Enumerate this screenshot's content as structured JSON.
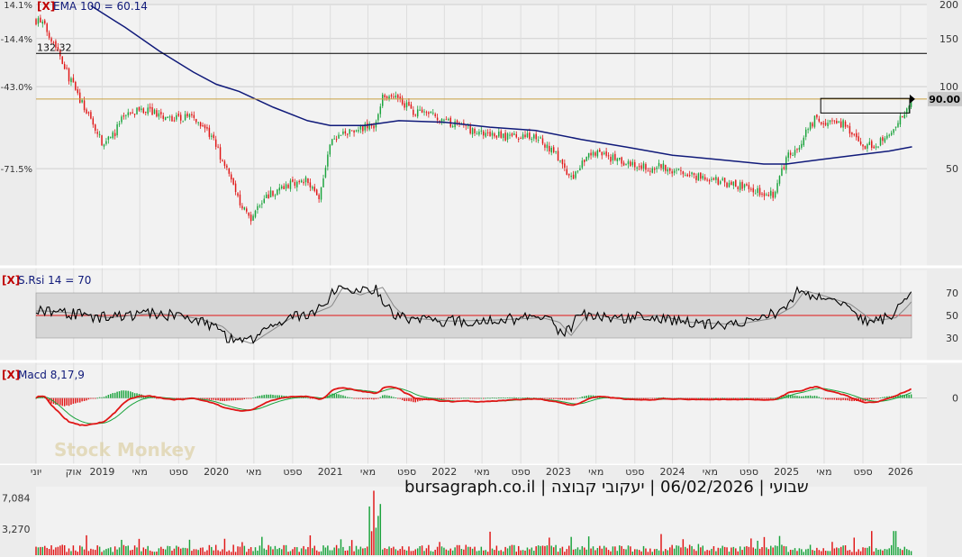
{
  "chart_data": [
    {
      "type": "candlestick",
      "panel": "price",
      "indicator_label": "EMA 100 = 60.14",
      "y_axis_right": [
        "200",
        "150",
        "100",
        "50"
      ],
      "y_axis_left": [
        "14.1%",
        "-14.4%",
        "-43.0%",
        "-71.5%"
      ],
      "reference_line_label": "132.32",
      "current_price_label": "90.00",
      "ylim": [
        22,
        200
      ],
      "approx_close_path": [
        [
          2018.45,
          175
        ],
        [
          2018.5,
          165
        ],
        [
          2018.55,
          152
        ],
        [
          2018.6,
          140
        ],
        [
          2018.7,
          110
        ],
        [
          2018.8,
          90
        ],
        [
          2018.9,
          75
        ],
        [
          2019.0,
          62
        ],
        [
          2019.1,
          66
        ],
        [
          2019.2,
          80
        ],
        [
          2019.4,
          82
        ],
        [
          2019.6,
          76
        ],
        [
          2019.8,
          78
        ],
        [
          2019.95,
          66
        ],
        [
          2020.1,
          48
        ],
        [
          2020.2,
          38
        ],
        [
          2020.3,
          33
        ],
        [
          2020.45,
          40
        ],
        [
          2020.6,
          43
        ],
        [
          2020.8,
          46
        ],
        [
          2020.9,
          38
        ],
        [
          2021.0,
          62
        ],
        [
          2021.2,
          70
        ],
        [
          2021.4,
          72
        ],
        [
          2021.45,
          90
        ],
        [
          2021.55,
          95
        ],
        [
          2021.7,
          82
        ],
        [
          2021.9,
          78
        ],
        [
          2022.1,
          72
        ],
        [
          2022.3,
          68
        ],
        [
          2022.6,
          65
        ],
        [
          2022.8,
          66
        ],
        [
          2023.0,
          55
        ],
        [
          2023.1,
          45
        ],
        [
          2023.3,
          58
        ],
        [
          2023.6,
          52
        ],
        [
          2023.8,
          50
        ],
        [
          2023.9,
          51
        ],
        [
          2024.2,
          47
        ],
        [
          2024.5,
          44
        ],
        [
          2024.7,
          42
        ],
        [
          2024.9,
          40
        ],
        [
          2025.0,
          55
        ],
        [
          2025.1,
          60
        ],
        [
          2025.25,
          76
        ],
        [
          2025.5,
          73
        ],
        [
          2025.65,
          60
        ],
        [
          2025.8,
          62
        ],
        [
          2025.95,
          68
        ],
        [
          2026.0,
          76
        ],
        [
          2026.1,
          90
        ]
      ],
      "ema_path": [
        [
          2018.9,
          198
        ],
        [
          2019.2,
          165
        ],
        [
          2019.5,
          135
        ],
        [
          2019.8,
          113
        ],
        [
          2020.0,
          102
        ],
        [
          2020.2,
          96
        ],
        [
          2020.5,
          84
        ],
        [
          2020.8,
          75
        ],
        [
          2021.0,
          72
        ],
        [
          2021.3,
          72
        ],
        [
          2021.6,
          75
        ],
        [
          2022.0,
          74
        ],
        [
          2022.4,
          71
        ],
        [
          2022.8,
          69
        ],
        [
          2023.2,
          64
        ],
        [
          2023.6,
          60
        ],
        [
          2024.0,
          56
        ],
        [
          2024.4,
          54
        ],
        [
          2024.8,
          52
        ],
        [
          2025.0,
          52
        ],
        [
          2025.3,
          54
        ],
        [
          2025.6,
          56
        ],
        [
          2025.9,
          58
        ],
        [
          2026.1,
          60.14
        ]
      ]
    },
    {
      "type": "line",
      "panel": "rsi",
      "indicator_label": "S.Rsi 14 = 70",
      "y_axis_right": [
        "70",
        "50",
        "30"
      ],
      "levels": [
        70,
        50,
        30
      ],
      "ylim": [
        10,
        90
      ],
      "approx_path": [
        [
          2018.45,
          54
        ],
        [
          2018.7,
          52
        ],
        [
          2019.0,
          48
        ],
        [
          2019.4,
          52
        ],
        [
          2019.6,
          50
        ],
        [
          2019.8,
          47
        ],
        [
          2020.0,
          40
        ],
        [
          2020.1,
          30
        ],
        [
          2020.25,
          25
        ],
        [
          2020.4,
          35
        ],
        [
          2020.6,
          48
        ],
        [
          2020.8,
          52
        ],
        [
          2020.95,
          58
        ],
        [
          2021.05,
          75
        ],
        [
          2021.2,
          68
        ],
        [
          2021.4,
          75
        ],
        [
          2021.5,
          58
        ],
        [
          2021.6,
          48
        ],
        [
          2022.0,
          45
        ],
        [
          2022.4,
          46
        ],
        [
          2022.8,
          48
        ],
        [
          2022.95,
          44
        ],
        [
          2023.05,
          32
        ],
        [
          2023.2,
          52
        ],
        [
          2023.5,
          46
        ],
        [
          2023.8,
          50
        ],
        [
          2024.1,
          44
        ],
        [
          2024.5,
          42
        ],
        [
          2024.8,
          47
        ],
        [
          2025.0,
          58
        ],
        [
          2025.1,
          72
        ],
        [
          2025.25,
          68
        ],
        [
          2025.5,
          60
        ],
        [
          2025.7,
          45
        ],
        [
          2025.9,
          48
        ],
        [
          2026.0,
          58
        ],
        [
          2026.1,
          70
        ]
      ]
    },
    {
      "type": "histogram",
      "panel": "macd",
      "indicator_label": "Macd 8,17,9",
      "y_axis_right": [
        "0"
      ],
      "ylim": [
        -40,
        20
      ]
    },
    {
      "type": "bar",
      "panel": "volume",
      "y_axis_left": [
        "7,084",
        "3,270"
      ],
      "ylim": [
        0,
        8500
      ]
    }
  ],
  "x_axis": {
    "labels": [
      "יוני",
      "אוק",
      "2019",
      "מאי",
      "ספט",
      "2020",
      "מאי",
      "ספט",
      "2021",
      "מאי",
      "ספט",
      "2022",
      "מאי",
      "ספט",
      "2023",
      "מאי",
      "ספט",
      "2024",
      "מאי",
      "ספט",
      "2025",
      "מאי",
      "ספט",
      "2026"
    ],
    "years": [
      2018.42,
      2018.75,
      2019.0,
      2019.33,
      2019.67,
      2020.0,
      2020.33,
      2020.67,
      2021.0,
      2021.33,
      2021.67,
      2022.0,
      2022.33,
      2022.67,
      2023.0,
      2023.33,
      2023.67,
      2024.0,
      2024.33,
      2024.67,
      2025.0,
      2025.33,
      2025.67,
      2026.0
    ]
  },
  "close_symbol": "[X]",
  "footer_text": "שבועי | 06/02/2026 | יעקובי קבוצה | bursagraph.co.il",
  "watermark": "Stock Monkey",
  "colors": {
    "up": "#1aa33c",
    "down": "#e01616",
    "ema": "#101a7a",
    "rsi": "#000000",
    "rsi_signal": "#888888",
    "rsi_mid": "#e01616",
    "macd": "#e01616",
    "macd_signal": "#1aa33c",
    "ref_black": "#000000",
    "ref_gold": "#c8a040",
    "label_blue": "#101a7a",
    "close_red": "#c00000",
    "text": "#222222"
  }
}
